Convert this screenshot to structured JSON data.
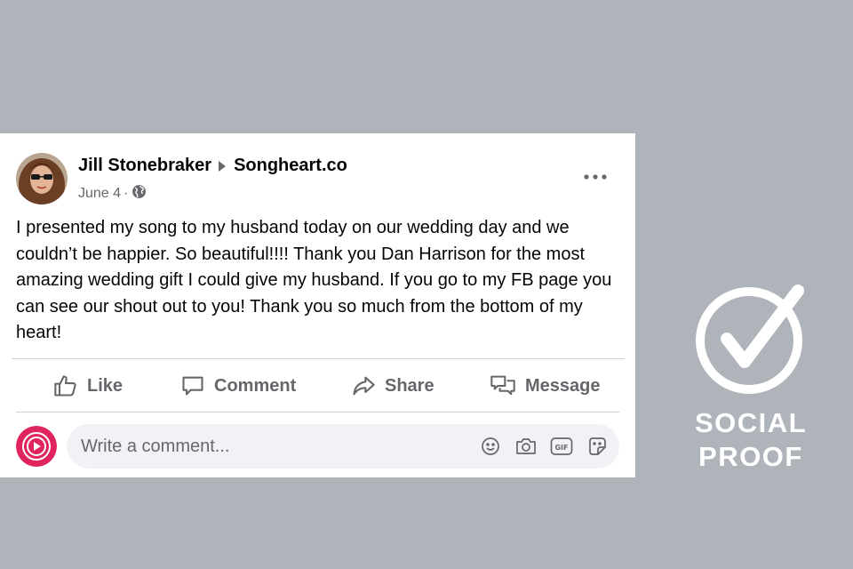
{
  "post": {
    "author": "Jill Stonebraker",
    "page": "Songheart.co",
    "date": "June 4",
    "separator": "·",
    "audience_icon": "globe-icon",
    "more_icon": "more-options-icon",
    "text": "I presented my song to my husband today on our wedding day and we couldn’t be happier. So beautiful!!!! Thank you Dan Harrison for the most amazing wedding gift I could give my husband. If you go to my FB page you can see our shout out to you! Thank you so much from the bottom of my heart!"
  },
  "actions": {
    "like": "Like",
    "comment": "Comment",
    "share": "Share",
    "message": "Message"
  },
  "comment_box": {
    "placeholder": "Write a comment...",
    "icons": [
      "emoji-icon",
      "camera-icon",
      "gif-icon",
      "sticker-icon"
    ]
  },
  "badge": {
    "line1": "SOCIAL",
    "line2": "PROOF"
  },
  "colors": {
    "background": "#afb3ba",
    "card": "#ffffff",
    "text": "#050505",
    "secondary": "#65676b",
    "brand_accent": "#e0245e"
  }
}
